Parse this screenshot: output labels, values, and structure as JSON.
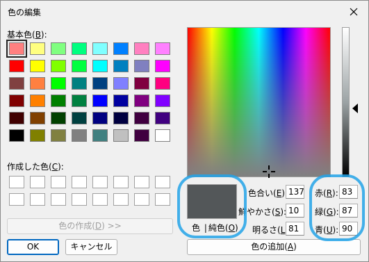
{
  "window": {
    "title": "色の編集",
    "close_glyph": "✕"
  },
  "basic": {
    "label_text": "基本色(",
    "label_key": "B",
    "label_end": "):",
    "colors": [
      "#ff8080",
      "#ffff80",
      "#80ff80",
      "#00ff80",
      "#80ffff",
      "#0080ff",
      "#ff80c0",
      "#ff80ff",
      "#ff0000",
      "#ffff00",
      "#80ff00",
      "#00ff40",
      "#00ffff",
      "#0080c0",
      "#8080c0",
      "#ff00ff",
      "#804040",
      "#ff8040",
      "#00ff00",
      "#008080",
      "#004080",
      "#8080ff",
      "#800040",
      "#ff0080",
      "#800000",
      "#ff8000",
      "#008000",
      "#008040",
      "#0000ff",
      "#0000a0",
      "#800080",
      "#8000ff",
      "#400000",
      "#804000",
      "#004000",
      "#004040",
      "#000080",
      "#000040",
      "#400040",
      "#400080",
      "#000000",
      "#808000",
      "#808040",
      "#808080",
      "#408080",
      "#c0c0c0",
      "#400040",
      "#ffffff"
    ]
  },
  "custom": {
    "label_text": "作成した色(",
    "label_key": "C",
    "label_end": "):"
  },
  "buttons": {
    "define_text": "色の作成(",
    "define_key": "D",
    "define_end": ") >>",
    "ok": "OK",
    "cancel": "キャンセル",
    "add_text": "色の追加(",
    "add_key": "A",
    "add_end": ")"
  },
  "preview": {
    "left_label": "色",
    "sep": "|",
    "right_text": "純色(",
    "right_key": "O",
    "right_end": ")",
    "color": "#535759"
  },
  "hsl": {
    "hue_text": "色合い(",
    "hue_key": "E",
    "hue_end": "):",
    "hue_value": "137",
    "sat_text": "鮮やかさ(",
    "sat_key": "S",
    "sat_end": "):",
    "sat_value": "10",
    "lum_text": "明るさ(",
    "lum_key": "L",
    "lum_end": "):",
    "lum_value": "81"
  },
  "rgb": {
    "red_text": "赤(",
    "red_key": "R",
    "red_end": "):",
    "red_value": "83",
    "green_text": "緑(",
    "green_key": "G",
    "green_end": "):",
    "green_value": "87",
    "blue_text": "青(",
    "blue_key": "U",
    "blue_end": "):",
    "blue_value": "90"
  },
  "colors": {
    "highlight": "#23a3e8",
    "accent": "#0067c0"
  },
  "icons": {
    "crosshair": "crosshair-icon",
    "arrow": "luminance-arrow-icon",
    "close": "close-icon"
  }
}
